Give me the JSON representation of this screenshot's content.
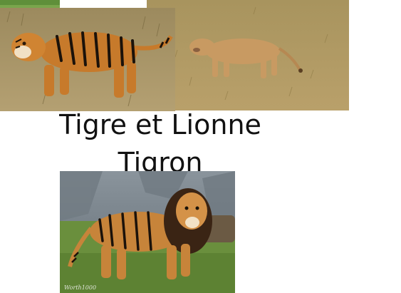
{
  "captions": {
    "line1": "Tigre et Lionne",
    "line2": "Tigron"
  },
  "images": {
    "tiger": {
      "icon": "tiger-photo"
    },
    "lioness": {
      "icon": "lioness-photo"
    },
    "tigon": {
      "icon": "tigon-photo",
      "watermark": "Worth1000"
    }
  },
  "colors": {
    "background": "#ffffff",
    "grass": "#b39a60",
    "tiger_orange": "#c77a2b",
    "lioness_tan": "#c89a62",
    "rock": "#7d8790",
    "lawn": "#6a8f3d"
  }
}
